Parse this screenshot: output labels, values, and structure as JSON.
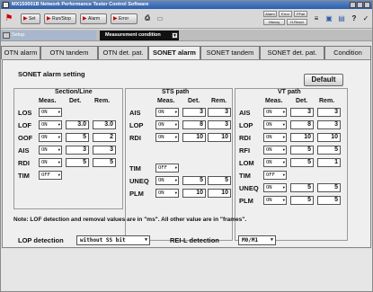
{
  "window": {
    "title": "MX150001B Network Performance Tester Control Software"
  },
  "toolbar": {
    "set_label": "Set",
    "runstop_label": "Run/Stop",
    "alarm_label": "Alarm",
    "error_label": "Error",
    "alarm_reset_label": "Alarm",
    "history_label": "History",
    "error_reset_label": "Error",
    "hold_label": "H.Reset",
    "pfail_label": "PFail"
  },
  "setup": {
    "label": "Setup",
    "mode": "Measurement condition"
  },
  "tabs": [
    {
      "label": "OTN alarm",
      "active": false
    },
    {
      "label": "OTN tandem",
      "active": false
    },
    {
      "label": "OTN det. pat.",
      "active": false
    },
    {
      "label": "SONET alarm",
      "active": true
    },
    {
      "label": "SONET tandem",
      "active": false
    },
    {
      "label": "SONET det. pat.",
      "active": false
    },
    {
      "label": "Condition",
      "active": false
    }
  ],
  "panel": {
    "heading": "SONET alarm setting",
    "default_button": "Default",
    "col_meas": "Meas.",
    "col_det": "Det.",
    "col_rem": "Rem.",
    "section": {
      "title": "Section/Line",
      "rows": [
        {
          "label": "LOS",
          "meas": "ON",
          "det": "",
          "rem": ""
        },
        {
          "label": "LOF",
          "meas": "ON",
          "det": "3.0",
          "rem": "3.0"
        },
        {
          "label": "OOF",
          "meas": "ON",
          "det": "5",
          "rem": "2"
        },
        {
          "label": "AIS",
          "meas": "ON",
          "det": "3",
          "rem": "3"
        },
        {
          "label": "RDI",
          "meas": "ON",
          "det": "5",
          "rem": "5"
        },
        {
          "label": "TIM",
          "meas": "OFF",
          "det": "",
          "rem": ""
        }
      ]
    },
    "sts": {
      "title": "STS path",
      "rows": [
        {
          "label": "AIS",
          "meas": "ON",
          "det": "3",
          "rem": "3"
        },
        {
          "label": "LOP",
          "meas": "ON",
          "det": "8",
          "rem": "3"
        },
        {
          "label": "RDI",
          "meas": "ON",
          "det": "10",
          "rem": "10"
        },
        {
          "label": "TIM",
          "meas": "OFF",
          "det": "",
          "rem": ""
        },
        {
          "label": "UNEQ",
          "meas": "ON",
          "det": "5",
          "rem": "5"
        },
        {
          "label": "PLM",
          "meas": "ON",
          "det": "10",
          "rem": "10"
        }
      ]
    },
    "vt": {
      "title": "VT path",
      "rows": [
        {
          "label": "AIS",
          "meas": "ON",
          "det": "3",
          "rem": "3"
        },
        {
          "label": "LOP",
          "meas": "ON",
          "det": "8",
          "rem": "3"
        },
        {
          "label": "RDI",
          "meas": "ON",
          "det": "10",
          "rem": "10"
        },
        {
          "label": "RFI",
          "meas": "ON",
          "det": "5",
          "rem": "5"
        },
        {
          "label": "LOM",
          "meas": "ON",
          "det": "5",
          "rem": "1"
        },
        {
          "label": "TIM",
          "meas": "OFF",
          "det": "",
          "rem": ""
        },
        {
          "label": "UNEQ",
          "meas": "ON",
          "det": "5",
          "rem": "5"
        },
        {
          "label": "PLM",
          "meas": "ON",
          "det": "5",
          "rem": "5"
        }
      ]
    },
    "note": "Note: LOF detection and removal values are in \"ms\".  All other value are in \"frames\".",
    "lop_label": "LOP detection",
    "lop_value": "without SS bit",
    "rei_label": "REI-L detection",
    "rei_value": "M0/M1"
  },
  "colors": {
    "accent": "#2e5ea8",
    "selected_field": "#111111"
  }
}
